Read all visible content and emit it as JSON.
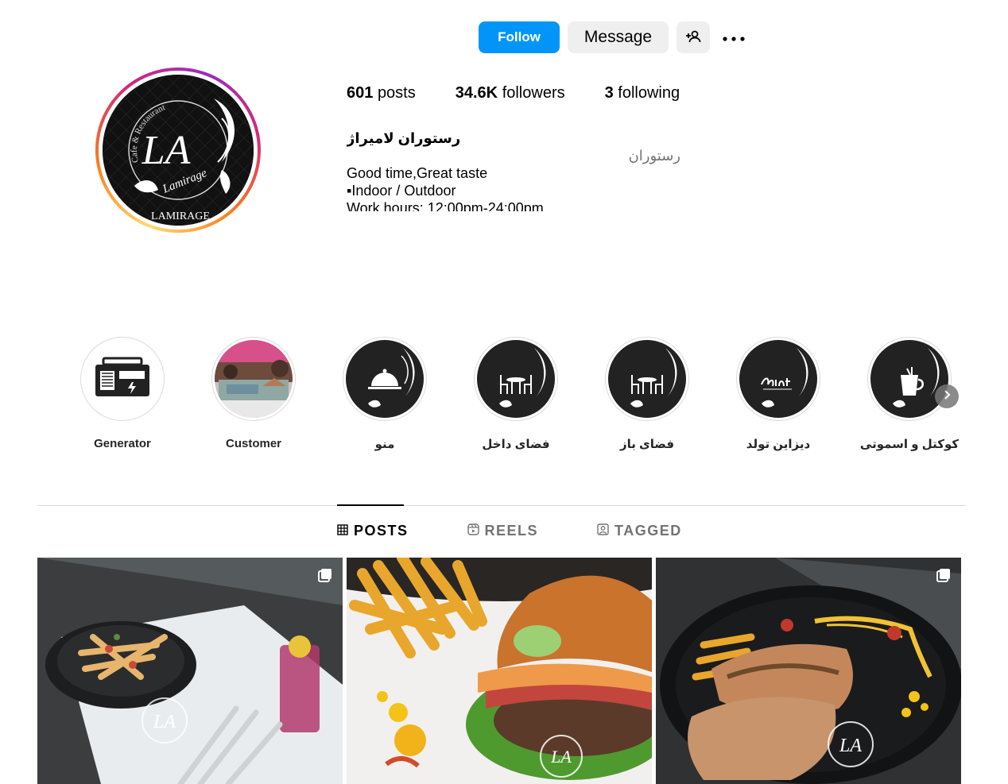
{
  "header": {
    "follow_label": "Follow",
    "message_label": "Message",
    "suggest_icon": "add-person-icon",
    "more_icon": "more-dots-icon"
  },
  "avatar": {
    "logo_text_main": "LA",
    "logo_text_script": "Lamirage",
    "logo_text_arc": "Cafe & Restaurant",
    "logo_text_bottom": "LAMIRAGE"
  },
  "stats": {
    "posts_count": "601",
    "posts_label": "posts",
    "followers_count": "34.6K",
    "followers_label": "followers",
    "following_count": "3",
    "following_label": "following"
  },
  "bio": {
    "name": "رستوران لامیراژ",
    "category": "رستوران",
    "line1": "Good time,Great taste",
    "line2": "▪Indoor / Outdoor",
    "line3": "Work hours: 12:00pm-24:00pm"
  },
  "highlights": [
    {
      "label": "Generator",
      "icon": "generator-icon"
    },
    {
      "label": "Customer",
      "icon": "photo-thumbnail"
    },
    {
      "label": "منو",
      "icon": "cloche-icon"
    },
    {
      "label": "فضای داخل",
      "icon": "table-chairs-icon"
    },
    {
      "label": "فضای باز",
      "icon": "table-chairs-icon"
    },
    {
      "label": "دیزاین تولد",
      "icon": "birthday-icon"
    },
    {
      "label": "کوکتل و اسموتی",
      "icon": "cocktail-icon"
    }
  ],
  "tabs": {
    "posts": "POSTS",
    "reels": "REELS",
    "tagged": "TAGGED"
  },
  "posts": [
    {
      "icon": "carousel-icon",
      "watermark": "LA"
    },
    {
      "icon": "",
      "watermark": "LA"
    },
    {
      "icon": "carousel-icon",
      "watermark": "LA"
    }
  ],
  "colors": {
    "follow_blue": "#0095f6",
    "button_gray": "#efefef",
    "muted_text": "#737373"
  }
}
